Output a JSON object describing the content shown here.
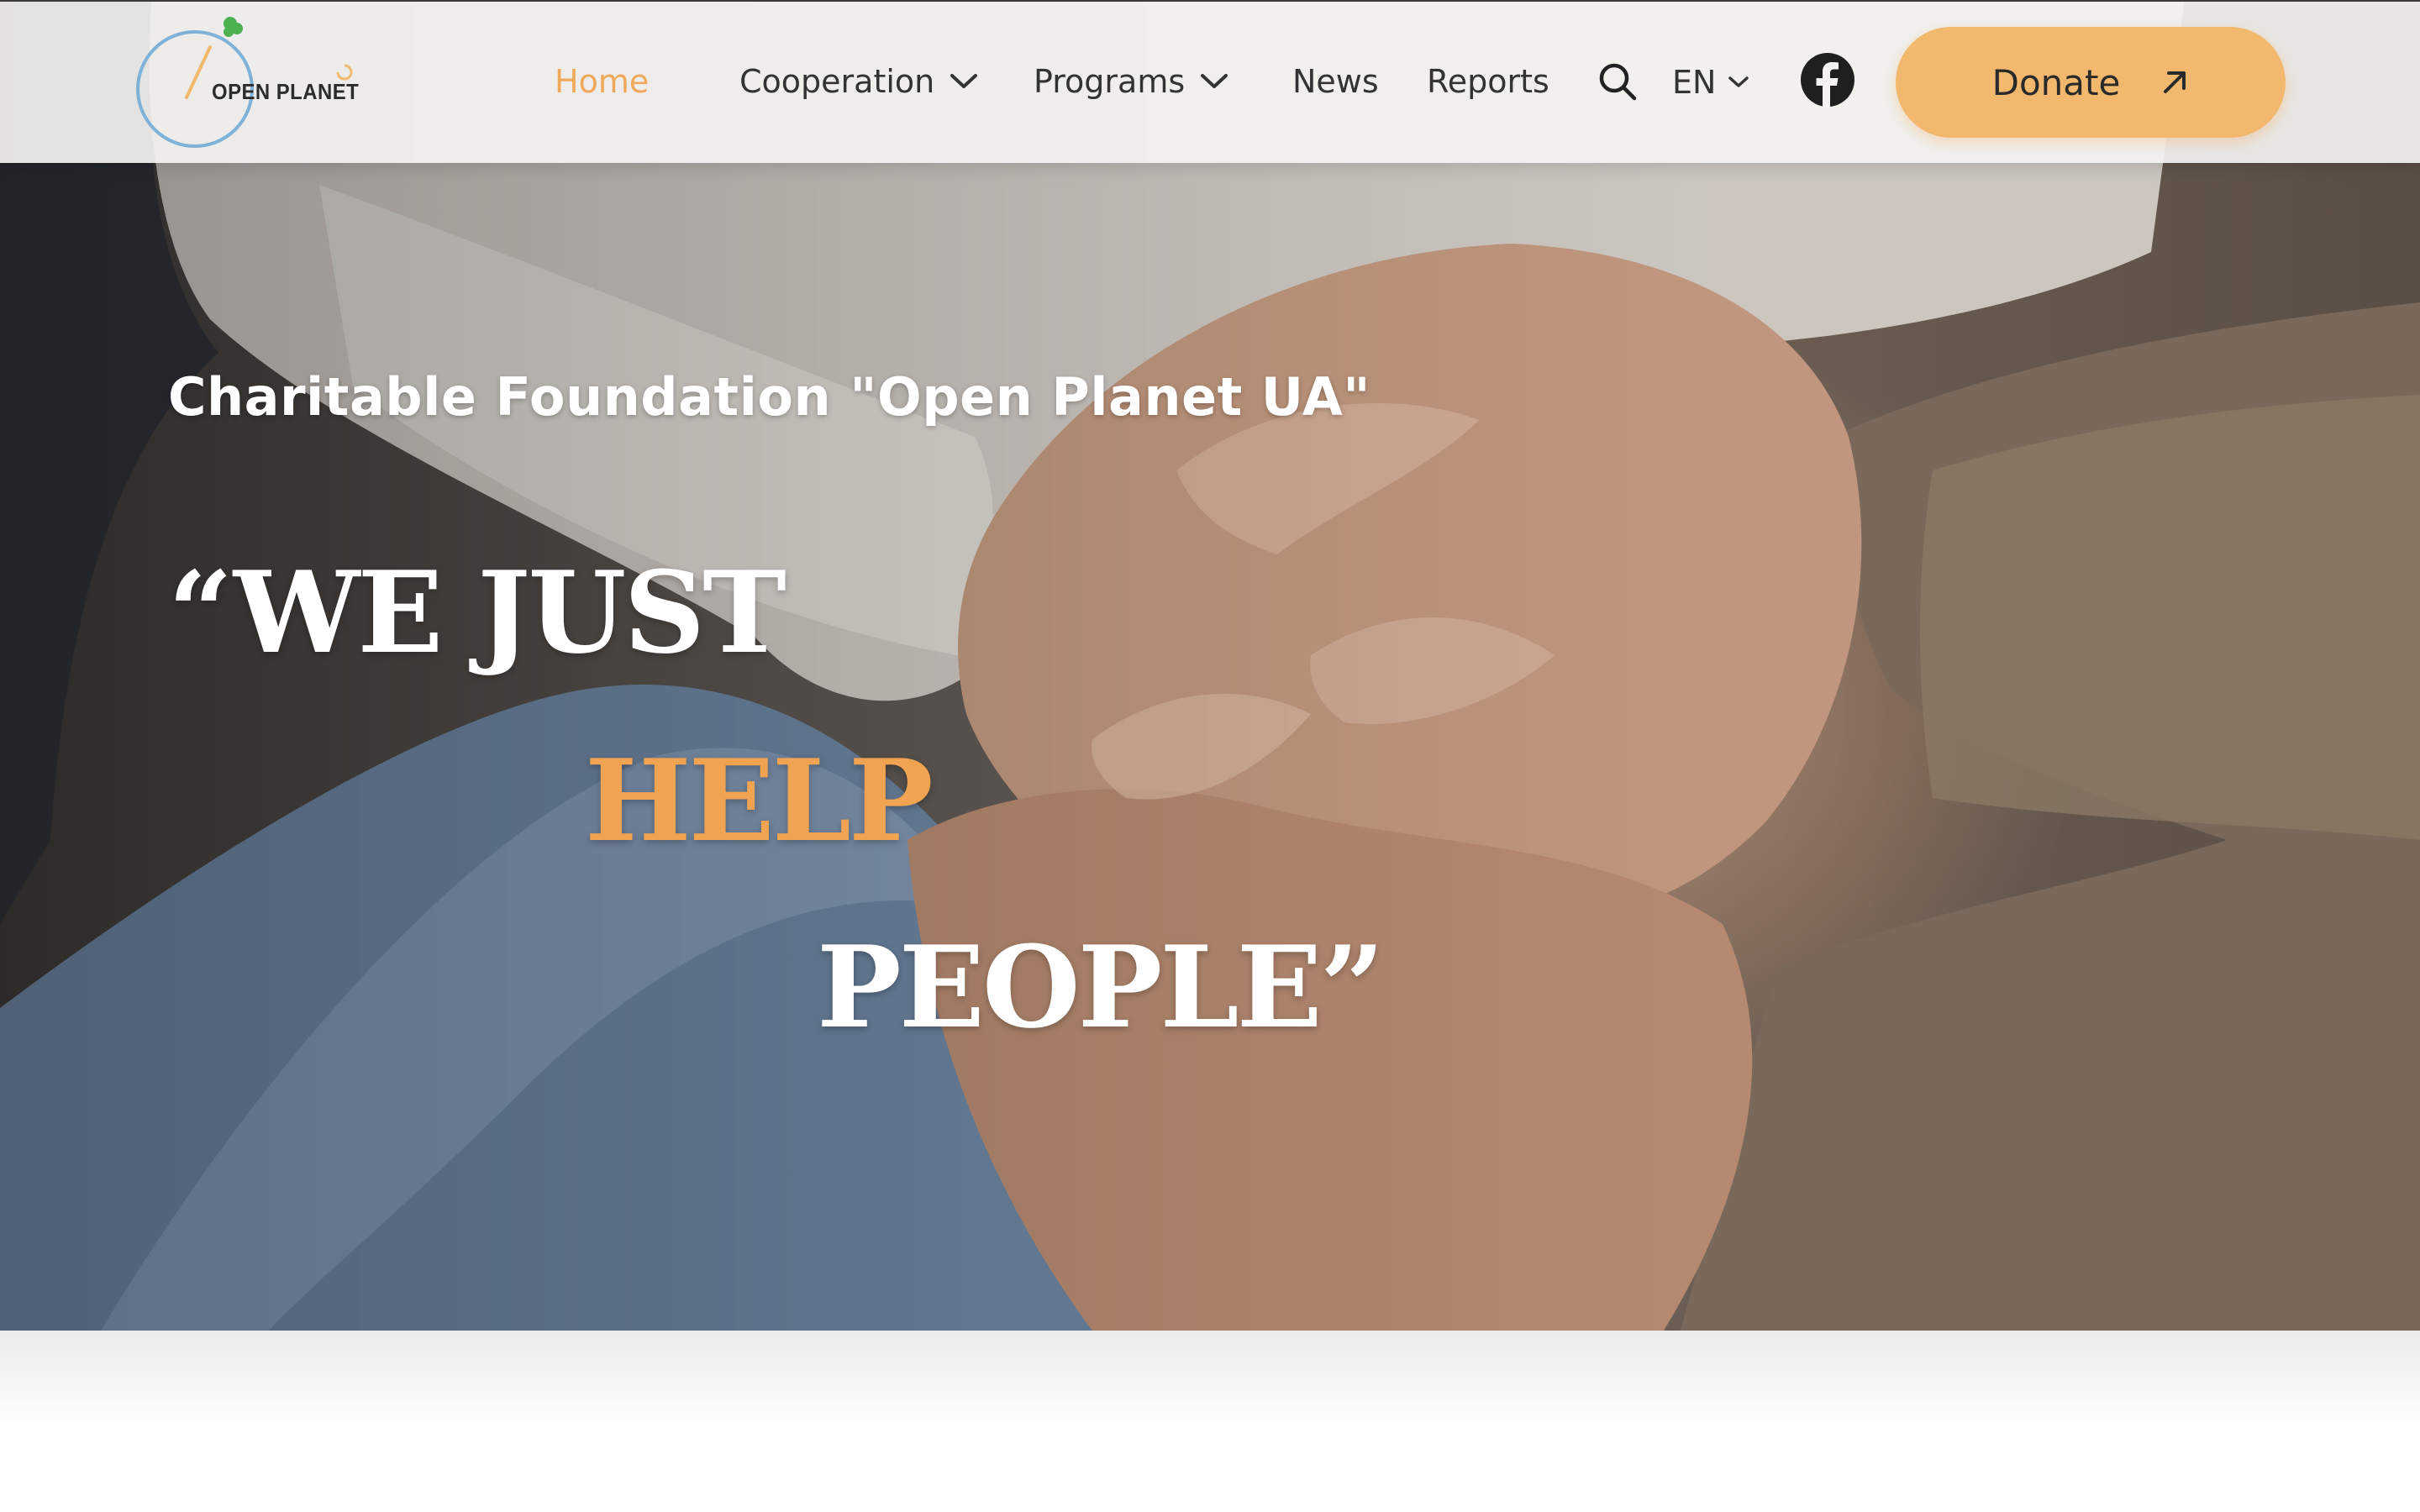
{
  "header": {
    "logo_text": "OPEN PLANET",
    "nav": [
      {
        "label": "Home",
        "active": true,
        "has_dropdown": false
      },
      {
        "label": "Cooperation",
        "active": false,
        "has_dropdown": true
      },
      {
        "label": "Programs",
        "active": false,
        "has_dropdown": true
      },
      {
        "label": "News",
        "active": false,
        "has_dropdown": false
      },
      {
        "label": "Reports",
        "active": false,
        "has_dropdown": false
      }
    ],
    "search_icon": "search-icon",
    "language": "EN",
    "social_icon": "facebook-icon",
    "donate_label": "Donate",
    "donate_icon": "arrow-up-right-icon"
  },
  "hero": {
    "subtitle": "Charitable Foundation \"Open Planet UA\"",
    "quote_line_1": "“WE JUST",
    "quote_line_2": "HELP",
    "quote_line_3": "PEOPLE”",
    "image": "hands-holding-photo"
  },
  "colors": {
    "accent": "#f0a85a",
    "donate_bg": "#f2b86d",
    "header_bg": "#f4f3f1",
    "text_dark": "#333333"
  }
}
